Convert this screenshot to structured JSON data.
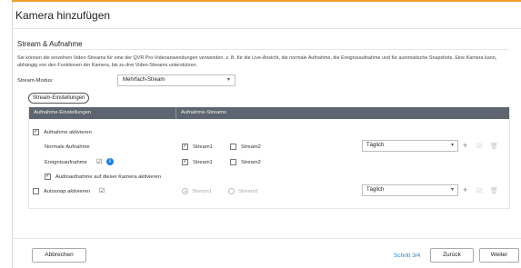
{
  "dialog": {
    "title": "Kamera hinzufügen"
  },
  "section": {
    "title": "Stream & Aufnahme",
    "description": "Sie können die einzelnen Video-Streams für eine der QVR Pro-Videoanwendungen verwenden, z. B. für die Live-Ansicht, die normale Aufnahme, die Ereignisaufnahme und für automatische Snapshots. Eine Kamera kann, abhängig von den Funktionen der Kamera, bis zu drei Video-Streams unterstützen."
  },
  "stream_mode": {
    "label": "Stream-Modus:",
    "value": "Mehrfach-Stream"
  },
  "stream_settings_button": "Stream-Einstellungen",
  "table": {
    "headers": [
      "Aufnahme-Einstellungen",
      "Aufnahme-Streams"
    ],
    "enable_recording": {
      "label": "Aufnahme aktivieren",
      "checked": true
    },
    "normal_recording": {
      "label": "Normale Aufnahme",
      "stream1": "Stream1",
      "stream1_checked": true,
      "stream2": "Stream2",
      "stream2_checked": false,
      "schedule": "Täglich"
    },
    "event_recording": {
      "label": "Ereignisaufnahme",
      "stream1": "Stream1",
      "stream1_checked": true,
      "stream2": "Stream2",
      "stream2_checked": false
    },
    "audio_recording": {
      "label": "Audioaufnahme auf dieser Kamera aktivieren",
      "checked": true
    },
    "autosnap": {
      "label": "Autosnap aktivieren",
      "checked": false,
      "stream1": "Stream1",
      "stream2": "Stream2",
      "schedule": "Täglich"
    }
  },
  "footer": {
    "cancel": "Abbrechen",
    "step": "Schritt 3/4",
    "back": "Zurück",
    "next": "Weiter"
  },
  "colors": {
    "accent": "#f0a030",
    "table_header": "#5d6570",
    "step_text": "#1f86d6",
    "info_icon": "#1d7ce0"
  },
  "icons": {
    "check": "✓",
    "caret": "▾",
    "plus": "+",
    "pencil": "✎",
    "info": "i",
    "edit_box": "☑",
    "delete": "🗑"
  }
}
